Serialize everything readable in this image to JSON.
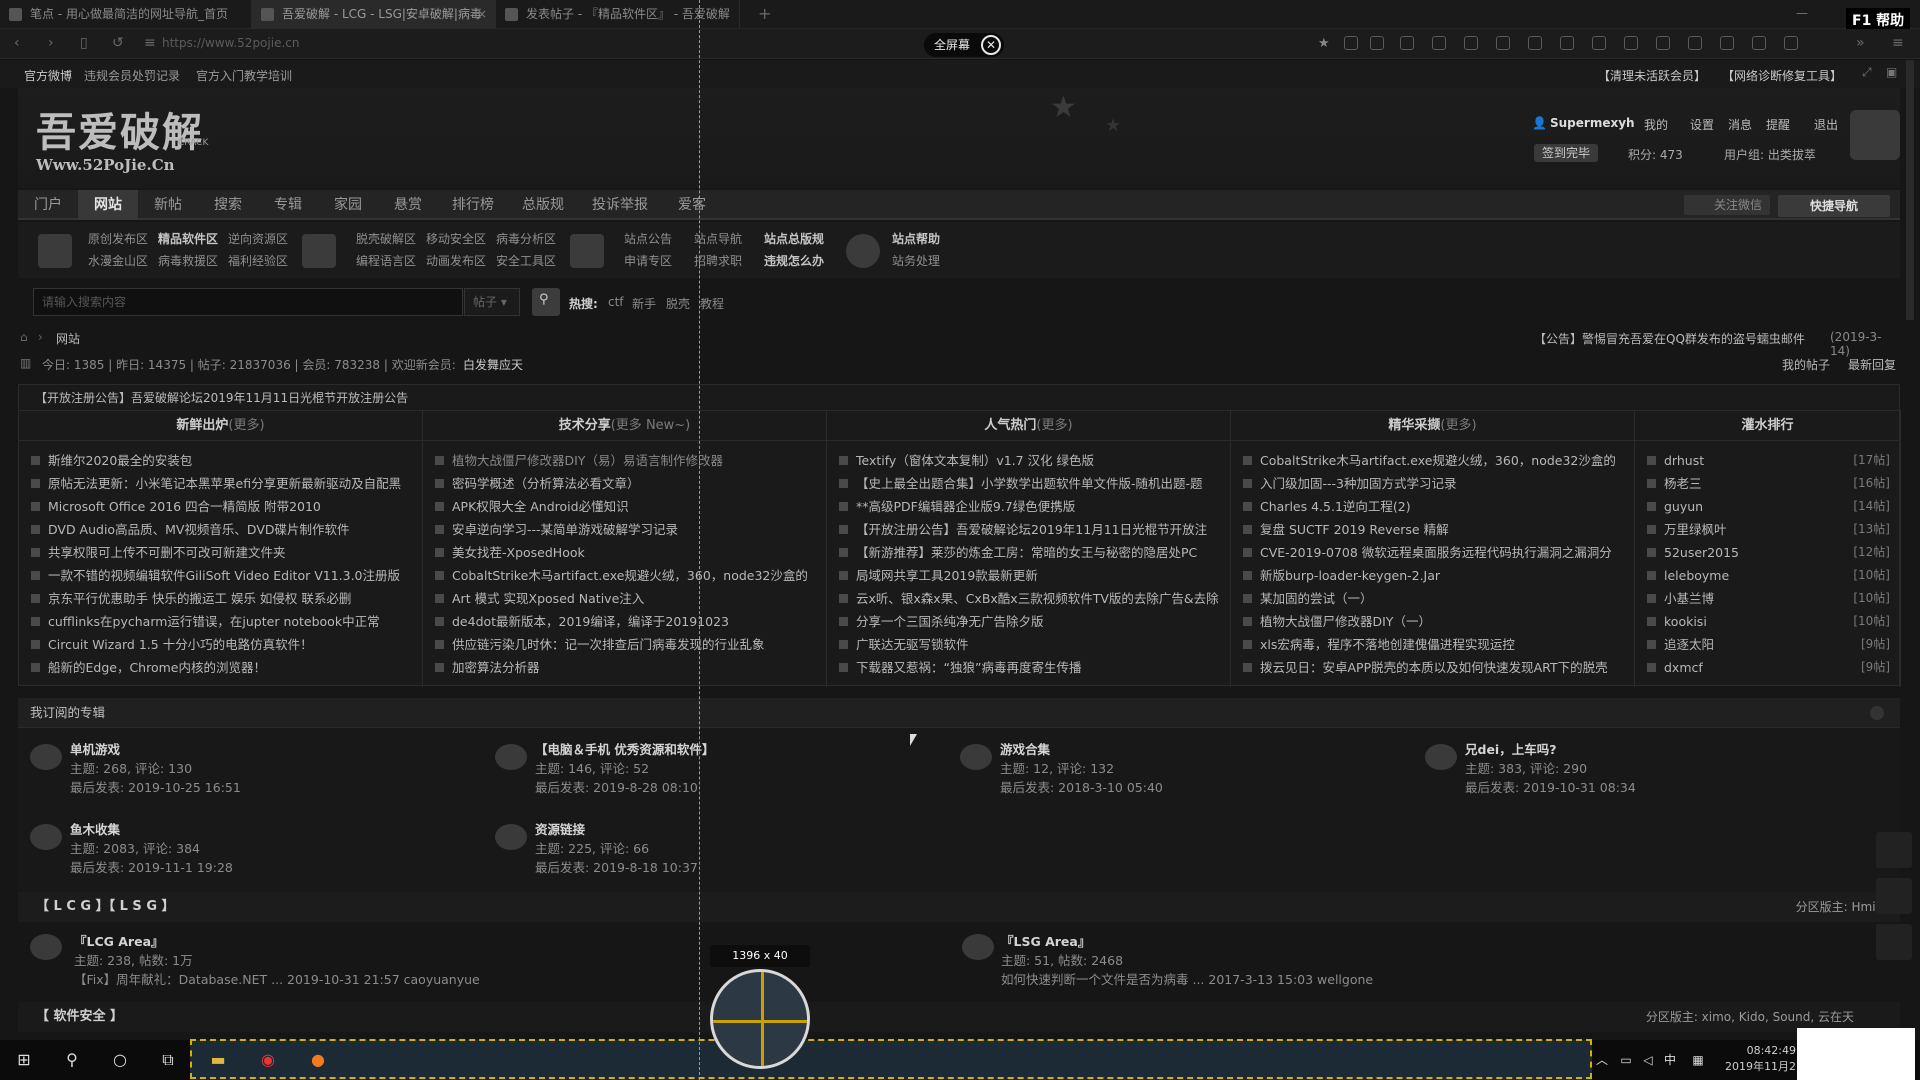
{
  "browser": {
    "tabs": [
      {
        "label": "笔点 - 用心做最简洁的网址导航_首页"
      },
      {
        "label": "吾爱破解 - LCG - LSG|安卓破解|病毒"
      },
      {
        "label": "发表帖子 - 『精品软件区』 - 吾爱破解"
      }
    ],
    "url": "https://www.52pojie.cn",
    "fullscreen_label": "全屏幕",
    "help_label": "F1 帮助"
  },
  "topstrip": {
    "left": [
      "官方微博",
      "违规会员处罚记录",
      "官方入门教学培训"
    ],
    "right": [
      "【清理未活跃会员】",
      "【网络诊断修复工具】"
    ]
  },
  "site": {
    "logo_main": "吾爱破解",
    "logo_sub": "Www.52PoJie.Cn",
    "logo_crack": "CRACK",
    "user": {
      "name": "Supermexyh",
      "links": [
        "我的",
        "设置",
        "消息",
        "提醒",
        "退出"
      ],
      "signin": "签到完毕",
      "points": "积分: 473",
      "group": "用户组: 出类拔萃"
    }
  },
  "mainnav": [
    "门户",
    "网站",
    "新帖",
    "搜索",
    "专辑",
    "家园",
    "悬赏",
    "排行榜",
    "总版规",
    "投诉举报",
    "爱客"
  ],
  "mainnav_right": {
    "wechat": "关注微信",
    "quick": "快捷导航"
  },
  "subnav": {
    "g1": {
      "r1": [
        "原创发布区",
        "精品软件区",
        "逆向资源区"
      ],
      "r2": [
        "水漫金山区",
        "病毒救援区",
        "福利经验区"
      ]
    },
    "g2": {
      "r1": [
        "脱壳破解区",
        "移动安全区",
        "病毒分析区"
      ],
      "r2": [
        "编程语言区",
        "动画发布区",
        "安全工具区"
      ]
    },
    "g3": {
      "r1": [
        "站点公告",
        "站点导航",
        "站点总版规"
      ],
      "r2": [
        "申请专区",
        "招聘求职",
        "违规怎么办"
      ]
    },
    "g4": {
      "r1": [
        "站点帮助"
      ],
      "r2": [
        "站务处理"
      ]
    }
  },
  "search": {
    "placeholder": "请输入搜索内容",
    "type": "帖子",
    "hot_label": "热搜:",
    "hot": [
      "ctf",
      "新手",
      "脱壳",
      "教程"
    ]
  },
  "crumb": {
    "label": "网站",
    "notice": "【公告】警惕冒充吾爱在QQ群发布的盗号蠕虫邮件",
    "notice_date": "(2019-3-14)"
  },
  "stats": {
    "text": "今日: 1385 | 昨日: 14375 | 帖子: 21837036 | 会员: 783238 | 欢迎新会员:",
    "newuser": "白发舞应天",
    "right": [
      "我的帖子",
      "最新回复"
    ]
  },
  "grid": {
    "announce": "【开放注册公告】吾爱破解论坛2019年11月11日光棍节开放注册公告",
    "cols": [
      {
        "head": "新鲜出炉",
        "more": "(更多)",
        "items": [
          "斯维尔2020最全的安装包",
          "原帖无法更新：小米笔记本黑苹果efi分享更新最新驱动及自配黑",
          "Microsoft Office 2016 四合一精简版 附带2010",
          "DVD Audio高品质、MV视频音乐、DVD碟片制作软件",
          "共享权限可上传不可删不可改可新建文件夹",
          "一款不错的视频编辑软件GiliSoft Video Editor V11.3.0注册版",
          "京东平行优惠助手 快乐的搬运工 娱乐 如侵权 联系必删",
          "cufflinks在pycharm运行错误，在jupter notebook中正常",
          "Circuit Wizard 1.5 十分小巧的电路仿真软件！",
          "船新的Edge，Chrome内核的浏览器！"
        ]
      },
      {
        "head": "技术分享",
        "more": "(更多 New~)",
        "items": [
          "植物大战僵尸修改器DIY（易）易语言制作修改器",
          "密码学概述（分析算法必看文章）",
          "APK权限大全 Android必懂知识",
          "安卓逆向学习---某简单游戏破解学习记录",
          "美女找茬-XposedHook",
          "CobaltStrike木马artifact.exe规避火绒，360，node32沙盒的",
          "Art 模式 实现Xposed Native注入",
          "de4dot最新版本，2019编译，编译于20191023",
          "供应链污染几时休：记一次排查后门病毒发现的行业乱象",
          "加密算法分析器"
        ]
      },
      {
        "head": "人气热门",
        "more": "(更多)",
        "items": [
          "Textify（窗体文本复制）v1.7 汉化 绿色版",
          "【史上最全出题合集】小学数学出题软件单文件版-随机出题-题",
          "**高级PDF编辑器企业版9.7绿色便携版",
          "【开放注册公告】吾爱破解论坛2019年11月11日光棍节开放注",
          "【新游推荐】莱莎的炼金工房：常暗的女王与秘密的隐居处PC",
          "局域网共享工具2019款最新更新",
          "云x听、银x森x果、CxBx酷x三款视频软件TV版的去除广告&去除",
          "分享一个三国杀纯净无广告除夕版",
          "广联达无驱写锁软件",
          "下载器又惹祸：“独狼”病毒再度寄生传播"
        ]
      },
      {
        "head": "精华采撷",
        "more": "(更多)",
        "items": [
          "CobaltStrike木马artifact.exe规避火绒，360，node32沙盒的",
          "入门级加固---3种加固方式学习记录",
          "Charles 4.5.1逆向工程(2)",
          "复盘 SUCTF 2019 Reverse 精解",
          "CVE-2019-0708 微软远程桌面服务远程代码执行漏洞之漏洞分",
          "新版burp-loader-keygen-2.Jar",
          "某加固的尝试（一）",
          "植物大战僵尸修改器DIY（一）",
          "xls宏病毒，程序不落地创建傀儡进程实现运控",
          "拨云见日：安卓APP脱壳的本质以及如何快速发现ART下的脱壳"
        ]
      },
      {
        "head": "灌水排行",
        "more": "",
        "items": [
          "drhust",
          "杨老三",
          "guyun",
          "万里绿枫叶",
          "52user2015",
          "leleboyme",
          "小基兰博",
          "kookisi",
          "追逐太阳",
          "dxmcf"
        ],
        "counts": [
          "[17帖]",
          "[16帖]",
          "[14帖]",
          "[13帖]",
          "[12帖]",
          "[10帖]",
          "[10帖]",
          "[10帖]",
          "[9帖]",
          "[9帖]"
        ]
      }
    ]
  },
  "subscribed": {
    "head": "我订阅的专辑",
    "items": [
      {
        "title": "单机游戏",
        "meta": "主题: 268, 评论: 130",
        "last": "最后发表: 2019-10-25 16:51"
      },
      {
        "title": "【电脑＆手机 优秀资源和软件】",
        "meta": "主题: 146, 评论: 52",
        "last": "最后发表: 2019-8-28 08:10"
      },
      {
        "title": "游戏合集",
        "meta": "主题: 12, 评论: 132",
        "last": "最后发表: 2018-3-10 05:40"
      },
      {
        "title": "兄dei，上车吗?",
        "meta": "主题: 383, 评论: 290",
        "last": "最后发表: 2019-10-31 08:34"
      },
      {
        "title": "鱼木收集",
        "meta": "主题: 2083, 评论: 384",
        "last": "最后发表: 2019-11-1 19:28"
      },
      {
        "title": "资源链接",
        "meta": "主题: 225, 评论: 66",
        "last": "最后发表: 2019-8-18 10:37"
      }
    ]
  },
  "lcg": {
    "head": "【 L C G 】【 L S G 】",
    "mod": "分区版主: Hmily",
    "forums": [
      {
        "title": "『LCG Area』",
        "meta": "主题: 238, 帖数: 1万",
        "last": "【Fix】周年献礼：Database.NET ... 2019-10-31 21:57 caoyuanyue"
      },
      {
        "title": "『LSG Area』",
        "meta": "主题: 51, 帖数: 2468",
        "last": "如何快速判断一个文件是否为病毒 ... 2017-3-13 15:03 wellgone"
      }
    ]
  },
  "safety": {
    "head": "【 软件安全 】",
    "mod": "分区版主: ximo, Kido, Sound, 云在天"
  },
  "overlay": {
    "size_label": "1396 x 40"
  },
  "taskbar": {
    "time": "08:42:49",
    "date": "2019年11月2"
  }
}
